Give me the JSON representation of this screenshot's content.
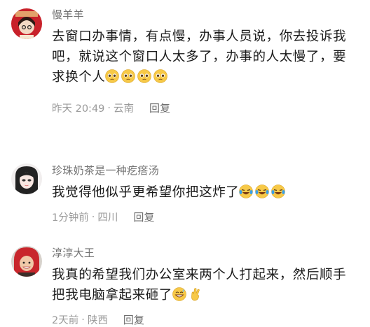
{
  "comments": [
    {
      "username": "慢羊羊",
      "lines": [
        "去窗口办事情，有点慢，办事人员说，你去投诉我",
        "吧，就说这个窗口人太多了，办事的人太慢了，要",
        "求换个人"
      ],
      "emojis": [
        "pleading-face-icon",
        "pleading-face-icon",
        "pleading-face-icon",
        "pleading-face-icon"
      ],
      "time": "昨天 20:49",
      "separator": "·",
      "location": "云南",
      "reply_label": "回复"
    },
    {
      "username": "珍珠奶茶是一种疙瘩汤",
      "lines": [
        "我觉得他似乎更希望你把这炸了"
      ],
      "emojis": [
        "laughing-tears-icon",
        "laughing-tears-icon",
        "laughing-tears-icon"
      ],
      "time": "1分钟前",
      "separator": "·",
      "location": "四川",
      "reply_label": "回复"
    },
    {
      "username": "淳淳大王",
      "lines": [
        "我真的希望我们办公室来两个人打起来，然后顺手",
        "把我电脑拿起来砸了"
      ],
      "emojis": [
        "grinning-sweat-icon",
        "crossed-fingers-icon"
      ],
      "time": "2天前",
      "separator": "·",
      "location": "陕西",
      "reply_label": "回复"
    }
  ],
  "colors": {
    "username": "#737373",
    "meta": "#9a9a9a",
    "emoji_yellow": "#f7c948"
  }
}
